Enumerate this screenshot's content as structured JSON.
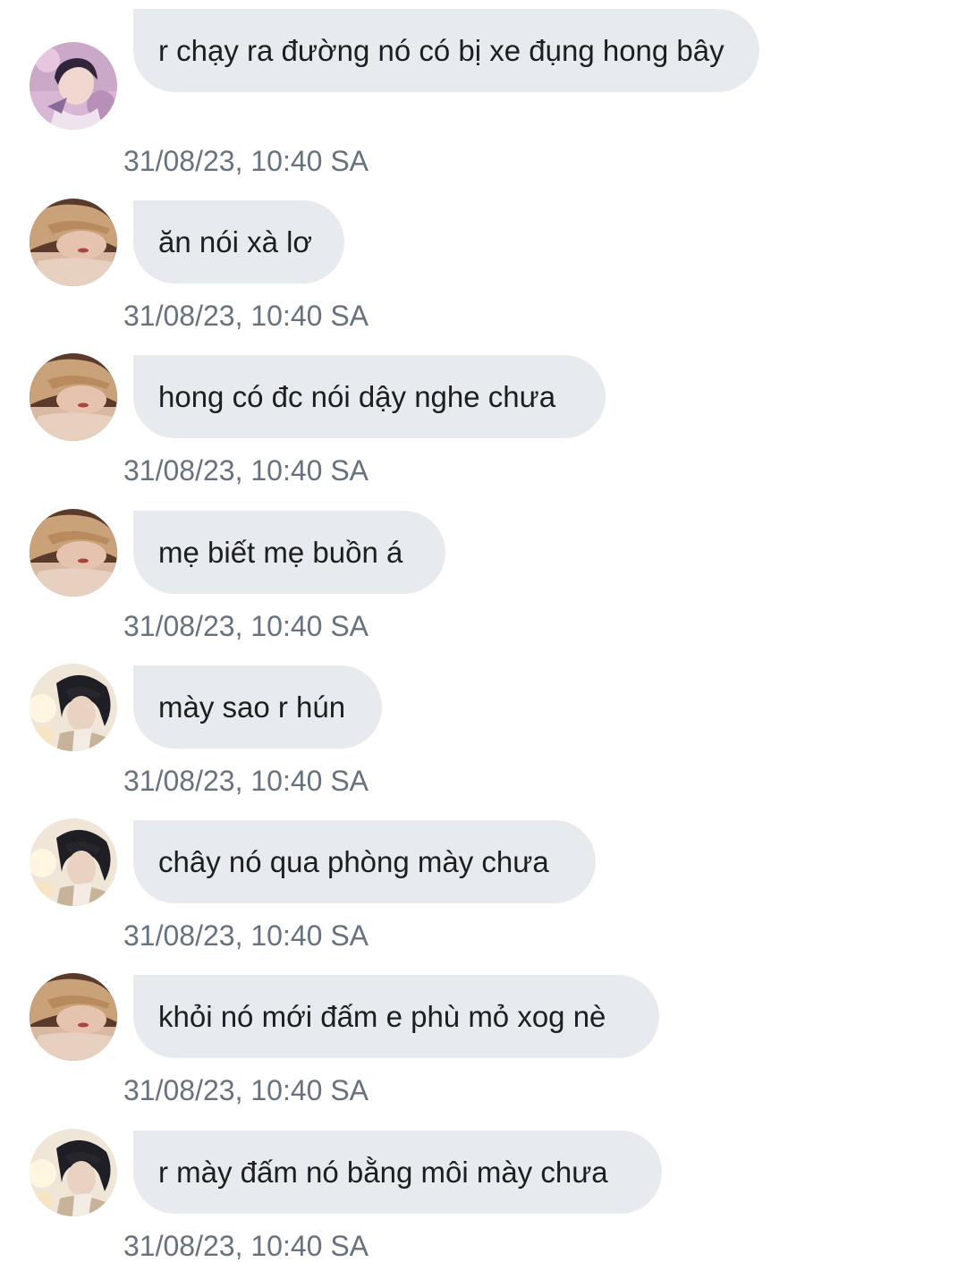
{
  "messages": [
    {
      "avatar": "avatar-pink-stage",
      "text": "r chạy ra đường nó có bị xe đụng hong bây",
      "time": "31/08/23, 10:40 SA"
    },
    {
      "avatar": "avatar-blonde-resting",
      "text": "ăn nói xà lơ",
      "time": "31/08/23, 10:40 SA"
    },
    {
      "avatar": "avatar-blonde-resting",
      "text": "hong có đc nói dậy nghe chưa",
      "time": "31/08/23, 10:40 SA"
    },
    {
      "avatar": "avatar-blonde-resting",
      "text": "mẹ biết mẹ buồn á",
      "time": "31/08/23, 10:40 SA"
    },
    {
      "avatar": "avatar-dark-hair-light",
      "text": "mày sao r hún",
      "time": "31/08/23, 10:40 SA"
    },
    {
      "avatar": "avatar-dark-hair-light",
      "text": "chây nó qua phòng mày chưa",
      "time": "31/08/23, 10:40 SA"
    },
    {
      "avatar": "avatar-blonde-resting",
      "text": "khỏi nó mới đấm e phù mỏ xog nè",
      "time": "31/08/23, 10:40 SA"
    },
    {
      "avatar": "avatar-dark-hair-light",
      "text": "r mày đấm nó bằng môi mày chưa",
      "time": "31/08/23, 10:40 SA"
    }
  ],
  "colors": {
    "bubble_background": "#e7ebef",
    "message_text": "#1c1e21",
    "timestamp_text": "#67727e",
    "page_background": "#ffffff"
  }
}
